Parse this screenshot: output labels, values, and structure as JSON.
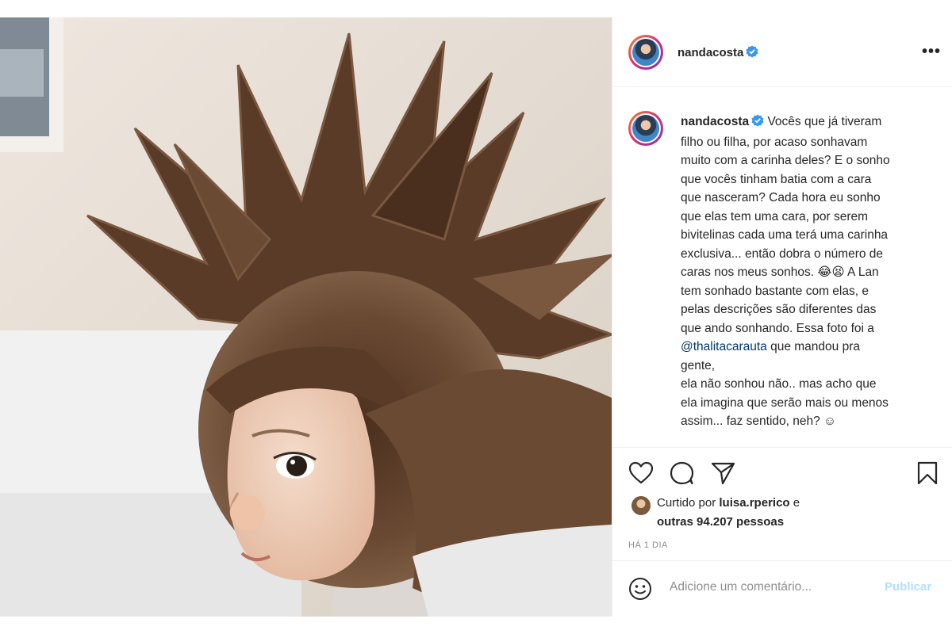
{
  "post": {
    "author": "nandacosta",
    "more_label": "•••",
    "caption_lines": [
      "Vocês que já tiveram",
      "filho ou filha, por acaso sonhavam",
      "muito com a carinha deles? E o sonho",
      "que vocês tinham batia com a cara",
      "que nasceram? Cada hora eu sonho",
      "que elas tem uma cara, por serem",
      "bivitelinas cada uma terá uma carinha",
      "exclusiva... então dobra o número de",
      "caras nos meus sonhos. 😂😫 A Lan",
      "tem sonhado bastante com elas, e",
      "pelas descrições são diferentes das",
      "que ando sonhando. Essa foto foi a"
    ],
    "mention": "@thalitacarauta",
    "mention_tail": " que mandou pra",
    "caption_lines_after": [
      "gente,",
      "ela não sonhou não.. mas acho que",
      "ela imagina que serão mais ou menos",
      "assim... faz sentido, neh? ☺"
    ],
    "liked_prefix": "Curtido por ",
    "liked_user": "luisa.rperico",
    "liked_mid": " e",
    "liked_others": "outras 94.207 pessoas",
    "time": "HÁ 1 DIA",
    "comment_placeholder": "Adicione um comentário...",
    "publish_label": "Publicar"
  },
  "icons": [
    "verified-badge-icon",
    "more-options-icon",
    "heart-icon",
    "comment-icon",
    "share-icon",
    "bookmark-icon",
    "emoji-icon"
  ],
  "colors": {
    "accent": "#0095f6",
    "publish_disabled": "#b2dffc",
    "mention": "#00376b",
    "muted": "#8e8e8e"
  }
}
